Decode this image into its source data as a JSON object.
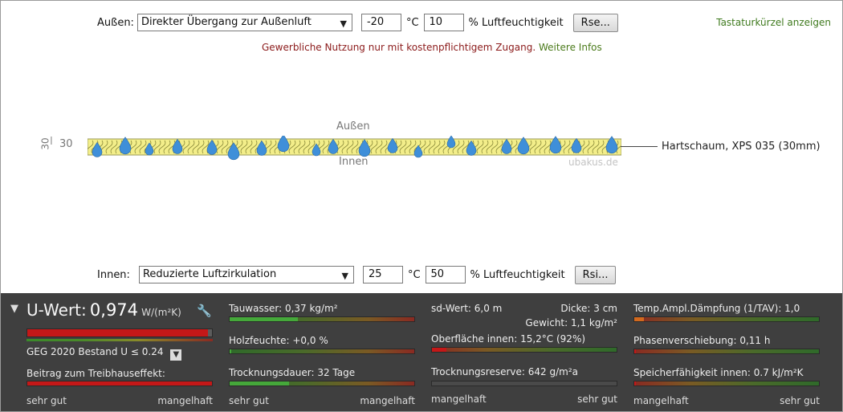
{
  "outside": {
    "label": "Außen:",
    "condition": "Direkter Übergang zur Außenluft",
    "temperature": "-20",
    "temp_unit": "°C",
    "humidity": "10",
    "humidity_unit": "% Luftfeuchtigkeit",
    "rs_button": "Rse..."
  },
  "inside": {
    "label": "Innen:",
    "condition": "Reduzierte Luftzirkulation",
    "temperature": "25",
    "temp_unit": "°C",
    "humidity": "50",
    "humidity_unit": "% Luftfeuchtigkeit",
    "rs_button": "Rsi..."
  },
  "shortcuts_link": "Tastaturkürzel anzeigen",
  "notice": {
    "text": "Gewerbliche Nutzung nur mit kostenpflichtigem Zugang.",
    "link": "Weitere Infos"
  },
  "diagram": {
    "outside_side": "Außen",
    "inside_side": "Innen",
    "thickness": "30",
    "thickness_rotated": "30",
    "material": "Hartschaum, XPS 035 (30mm)",
    "watermark": "ubakus.de",
    "layer_color": "#f3ee8a",
    "drop_color": "#3f8fd9"
  },
  "results": {
    "uvalue": {
      "title": "U-Wert:",
      "value": "0,974",
      "unit": "W/(m²K)",
      "bar_fraction": 0.98,
      "standard": "GEG 2020 Bestand U ≤ 0.24",
      "greenhouse_label": "Beitrag zum Treibhauseffekt:",
      "greenhouse_fraction": 1.0,
      "scale_left": "sehr gut",
      "scale_right": "mangelhaft"
    },
    "col2": {
      "condensate": "Tauwasser: 0,37 kg/m²",
      "condensate_fraction": 0.37,
      "wood_moisture": "Holzfeuchte: +0,0 %",
      "wood_fraction": 0.01,
      "drying_time": "Trocknungsdauer: 32 Tage",
      "drying_fraction": 0.32,
      "scale_left": "sehr gut",
      "scale_right": "mangelhaft"
    },
    "col3": {
      "sd_value": "sd-Wert: 6,0 m",
      "thickness": "Dicke: 3 cm",
      "weight": "Gewicht: 1,1 kg/m²",
      "surface_temp": "Oberfläche innen: 15,2°C (92%)",
      "surface_fraction": 0.08,
      "drying_reserve": "Trocknungsreserve: 642 g/m²a",
      "scale_left": "mangelhaft",
      "scale_right": "sehr gut"
    },
    "col4": {
      "damping": "Temp.Ampl.Dämpfung (1/TAV): 1,0",
      "damping_fraction": 0.05,
      "phase_shift": "Phasenverschiebung: 0,11 h",
      "phase_fraction": 0.01,
      "heat_capacity": "Speicherfähigkeit innen: 0.7 kJ/m²K",
      "capacity_fraction": 0.01,
      "scale_left": "mangelhaft",
      "scale_right": "sehr gut"
    }
  }
}
